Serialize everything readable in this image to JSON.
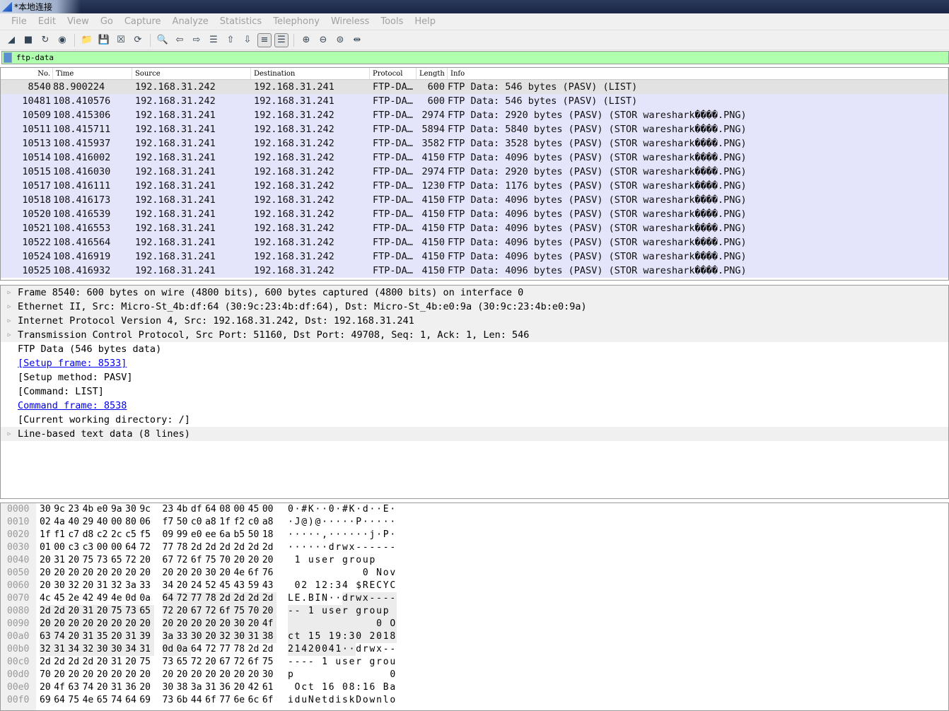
{
  "window": {
    "title": "*本地连接"
  },
  "menu": [
    "File",
    "Edit",
    "View",
    "Go",
    "Capture",
    "Analyze",
    "Statistics",
    "Telephony",
    "Wireless",
    "Tools",
    "Help"
  ],
  "toolbar": [
    {
      "icon": "start-capture-icon",
      "g": "◢"
    },
    {
      "icon": "stop-capture-icon",
      "g": "■"
    },
    {
      "icon": "restart-capture-icon",
      "g": "↻"
    },
    {
      "icon": "capture-options-icon",
      "g": "◉"
    },
    {
      "sep": true
    },
    {
      "icon": "open-file-icon",
      "g": "📁"
    },
    {
      "icon": "save-file-icon",
      "g": "💾"
    },
    {
      "icon": "close-file-icon",
      "g": "☒"
    },
    {
      "icon": "reload-icon",
      "g": "⟳"
    },
    {
      "sep": true
    },
    {
      "icon": "find-packet-icon",
      "g": "🔍"
    },
    {
      "icon": "go-back-icon",
      "g": "⇦"
    },
    {
      "icon": "go-forward-icon",
      "g": "⇨"
    },
    {
      "icon": "go-to-packet-icon",
      "g": "☰"
    },
    {
      "icon": "first-packet-icon",
      "g": "⇧"
    },
    {
      "icon": "last-packet-icon",
      "g": "⇩"
    },
    {
      "icon": "autoscroll-icon",
      "g": "≡",
      "boxed": true
    },
    {
      "icon": "colorize-icon",
      "g": "☰",
      "boxed": true
    },
    {
      "sep": true
    },
    {
      "icon": "zoom-in-icon",
      "g": "⊕"
    },
    {
      "icon": "zoom-out-icon",
      "g": "⊖"
    },
    {
      "icon": "zoom-normal-icon",
      "g": "⊜"
    },
    {
      "icon": "resize-columns-icon",
      "g": "⇹"
    }
  ],
  "filter": {
    "value": "ftp-data"
  },
  "packet_list": {
    "columns": [
      "No.",
      "Time",
      "Source",
      "Destination",
      "Protocol",
      "Length",
      "Info"
    ],
    "selected_index": 0,
    "rows": [
      [
        "8540",
        "88.900224",
        "192.168.31.242",
        "192.168.31.241",
        "FTP-DA…",
        "600",
        "FTP Data: 546 bytes (PASV) (LIST)"
      ],
      [
        "10481",
        "108.410576",
        "192.168.31.242",
        "192.168.31.241",
        "FTP-DA…",
        "600",
        "FTP Data: 546 bytes (PASV) (LIST)"
      ],
      [
        "10509",
        "108.415306",
        "192.168.31.241",
        "192.168.31.242",
        "FTP-DA…",
        "2974",
        "FTP Data: 2920 bytes (PASV) (STOR wareshark����.PNG)"
      ],
      [
        "10511",
        "108.415711",
        "192.168.31.241",
        "192.168.31.242",
        "FTP-DA…",
        "5894",
        "FTP Data: 5840 bytes (PASV) (STOR wareshark����.PNG)"
      ],
      [
        "10513",
        "108.415937",
        "192.168.31.241",
        "192.168.31.242",
        "FTP-DA…",
        "3582",
        "FTP Data: 3528 bytes (PASV) (STOR wareshark����.PNG)"
      ],
      [
        "10514",
        "108.416002",
        "192.168.31.241",
        "192.168.31.242",
        "FTP-DA…",
        "4150",
        "FTP Data: 4096 bytes (PASV) (STOR wareshark����.PNG)"
      ],
      [
        "10515",
        "108.416030",
        "192.168.31.241",
        "192.168.31.242",
        "FTP-DA…",
        "2974",
        "FTP Data: 2920 bytes (PASV) (STOR wareshark����.PNG)"
      ],
      [
        "10517",
        "108.416111",
        "192.168.31.241",
        "192.168.31.242",
        "FTP-DA…",
        "1230",
        "FTP Data: 1176 bytes (PASV) (STOR wareshark����.PNG)"
      ],
      [
        "10518",
        "108.416173",
        "192.168.31.241",
        "192.168.31.242",
        "FTP-DA…",
        "4150",
        "FTP Data: 4096 bytes (PASV) (STOR wareshark����.PNG)"
      ],
      [
        "10520",
        "108.416539",
        "192.168.31.241",
        "192.168.31.242",
        "FTP-DA…",
        "4150",
        "FTP Data: 4096 bytes (PASV) (STOR wareshark����.PNG)"
      ],
      [
        "10521",
        "108.416553",
        "192.168.31.241",
        "192.168.31.242",
        "FTP-DA…",
        "4150",
        "FTP Data: 4096 bytes (PASV) (STOR wareshark����.PNG)"
      ],
      [
        "10522",
        "108.416564",
        "192.168.31.241",
        "192.168.31.242",
        "FTP-DA…",
        "4150",
        "FTP Data: 4096 bytes (PASV) (STOR wareshark����.PNG)"
      ],
      [
        "10524",
        "108.416919",
        "192.168.31.241",
        "192.168.31.242",
        "FTP-DA…",
        "4150",
        "FTP Data: 4096 bytes (PASV) (STOR wareshark����.PNG)"
      ],
      [
        "10525",
        "108.416932",
        "192.168.31.241",
        "192.168.31.242",
        "FTP-DA…",
        "4150",
        "FTP Data: 4096 bytes (PASV) (STOR wareshark����.PNG)"
      ]
    ]
  },
  "details": [
    {
      "text": "Frame 8540: 600 bytes on wire (4800 bits), 600 bytes captured (4800 bits) on interface 0",
      "expandable": true
    },
    {
      "text": "Ethernet II, Src: Micro-St_4b:df:64 (30:9c:23:4b:df:64), Dst: Micro-St_4b:e0:9a (30:9c:23:4b:e0:9a)",
      "expandable": true
    },
    {
      "text": "Internet Protocol Version 4, Src: 192.168.31.242, Dst: 192.168.31.241",
      "expandable": true
    },
    {
      "text": "Transmission Control Protocol, Src Port: 51160, Dst Port: 49708, Seq: 1, Ack: 1, Len: 546",
      "expandable": true
    },
    {
      "text": "FTP Data (546 bytes data)"
    },
    {
      "text": "[Setup frame: 8533]",
      "link": true
    },
    {
      "text": "[Setup method: PASV]"
    },
    {
      "text": "[Command: LIST]"
    },
    {
      "text": "Command frame: 8538",
      "link": true
    },
    {
      "text": "[Current working directory: /]"
    },
    {
      "text": "Line-based text data (8 lines)",
      "expandable": true
    }
  ],
  "hex": {
    "highlight_bytes": [
      120,
      185
    ],
    "rows": [
      {
        "off": "0000",
        "hex": "30 9c 23 4b e0 9a 30 9c 23 4b df 64 08 00 45 00",
        "ascii": "0·#K··0·#K·d··E·"
      },
      {
        "off": "0010",
        "hex": "02 4a 40 29 40 00 80 06 f7 50 c0 a8 1f f2 c0 a8",
        "ascii": "·J@)@·····P·····"
      },
      {
        "off": "0020",
        "hex": "1f f1 c7 d8 c2 2c c5 f5 09 99 e0 ee 6a b5 50 18",
        "ascii": "·····,······j·P·"
      },
      {
        "off": "0030",
        "hex": "01 00 c3 c3 00 00 64 72 77 78 2d 2d 2d 2d 2d 2d",
        "ascii": "······drwx------"
      },
      {
        "off": "0040",
        "hex": "20 31 20 75 73 65 72 20 67 72 6f 75 70 20 20 20",
        "ascii": " 1 user group   "
      },
      {
        "off": "0050",
        "hex": "20 20 20 20 20 20 20 20 20 20 20 30 20 4e 6f 76",
        "ascii": "           0 Nov"
      },
      {
        "off": "0060",
        "hex": "20 30 32 20 31 32 3a 33 34 20 24 52 45 43 59 43",
        "ascii": " 02 12:34 $RECYC"
      },
      {
        "off": "0070",
        "hex": "4c 45 2e 42 49 4e 0d 0a 64 72 77 78 2d 2d 2d 2d",
        "ascii": "LE.BIN··drwx----"
      },
      {
        "off": "0080",
        "hex": "2d 2d 20 31 20 75 73 65 72 20 67 72 6f 75 70 20",
        "ascii": "-- 1 user group "
      },
      {
        "off": "0090",
        "hex": "20 20 20 20 20 20 20 20 20 20 20 20 20 30 20 4f",
        "ascii": "             0 O"
      },
      {
        "off": "00a0",
        "hex": "63 74 20 31 35 20 31 39 3a 33 30 20 32 30 31 38",
        "ascii": "ct 15 19:30 2018"
      },
      {
        "off": "00b0",
        "hex": "32 31 34 32 30 30 34 31 0d 0a 64 72 77 78 2d 2d",
        "ascii": "21420041··drwx--"
      },
      {
        "off": "00c0",
        "hex": "2d 2d 2d 2d 20 31 20 75 73 65 72 20 67 72 6f 75",
        "ascii": "---- 1 user grou"
      },
      {
        "off": "00d0",
        "hex": "70 20 20 20 20 20 20 20 20 20 20 20 20 20 20 30",
        "ascii": "p              0"
      },
      {
        "off": "00e0",
        "hex": "20 4f 63 74 20 31 36 20 30 38 3a 31 36 20 42 61",
        "ascii": " Oct 16 08:16 Ba"
      },
      {
        "off": "00f0",
        "hex": "69 64 75 4e 65 74 64 69 73 6b 44 6f 77 6e 6c 6f",
        "ascii": "iduNetdiskDownlo"
      }
    ]
  },
  "colors": {
    "filter_valid": "#afffaf",
    "row_bg": "#e4e4fa",
    "row_selected": "#e2e2e2"
  }
}
